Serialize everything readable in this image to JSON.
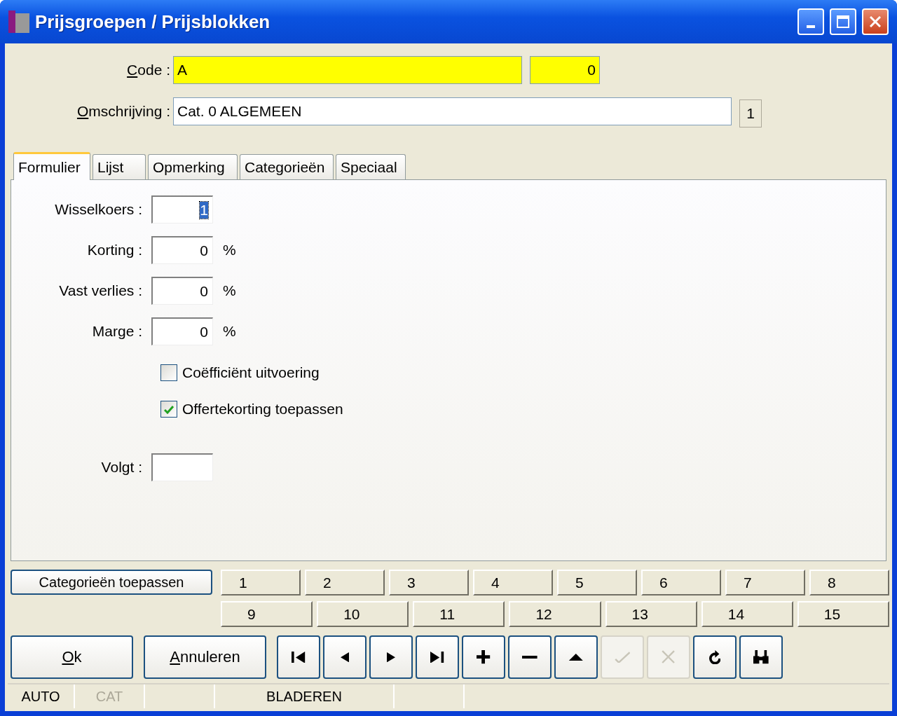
{
  "window": {
    "title": "Prijsgroepen / Prijsblokken"
  },
  "header": {
    "code_label": "Code :",
    "code_underline_first": true,
    "code_value": "A",
    "code_number": "0",
    "description_label": "Omschrijving :",
    "description_underline_first": true,
    "description_value": "Cat. 0  ALGEMEEN",
    "page_indicator": "1"
  },
  "tabs": [
    {
      "label": "Formulier",
      "selected": true
    },
    {
      "label": "Lijst",
      "selected": false
    },
    {
      "label": "Opmerking",
      "selected": false
    },
    {
      "label": "Categorieën",
      "selected": false
    },
    {
      "label": "Speciaal",
      "selected": false
    }
  ],
  "form": {
    "fields": [
      {
        "label": "Wisselkoers :",
        "value": "1",
        "focused": true
      },
      {
        "label": "Korting :",
        "value": "0",
        "unit": "%",
        "focused": false
      },
      {
        "label": "Vast verlies :",
        "value": "0",
        "unit": "%",
        "focused": false
      },
      {
        "label": "Marge :",
        "value": "0",
        "unit": "%",
        "focused": false
      }
    ],
    "checkboxes": [
      {
        "label": "Coëfficiënt uitvoering",
        "checked": false
      },
      {
        "label": "Offertekorting toepassen",
        "checked": true
      }
    ],
    "volgt": {
      "label": "Volgt :"
    }
  },
  "category_button": "Categorieën toepassen",
  "category_rows": [
    [
      "1",
      "2",
      "3",
      "4",
      "5",
      "6",
      "7",
      "8"
    ],
    [
      "9",
      "10",
      "11",
      "12",
      "13",
      "14",
      "15"
    ]
  ],
  "action_buttons": [
    {
      "label": "Ok",
      "underline_first": true
    },
    {
      "label": "Annuleren",
      "underline_first": true
    }
  ],
  "nav_buttons": [
    {
      "kind": "first",
      "disabled": false
    },
    {
      "kind": "prev",
      "disabled": false
    },
    {
      "kind": "next",
      "disabled": false
    },
    {
      "kind": "last",
      "disabled": false
    },
    {
      "kind": "add",
      "disabled": false
    },
    {
      "kind": "remove",
      "disabled": false
    },
    {
      "kind": "up",
      "disabled": false
    },
    {
      "kind": "confirm",
      "disabled": true
    },
    {
      "kind": "cancel",
      "disabled": true
    },
    {
      "kind": "refresh",
      "disabled": false
    },
    {
      "kind": "search",
      "disabled": false
    }
  ],
  "status_bar": [
    {
      "text": "AUTO",
      "disabled": false
    },
    {
      "text": "CAT",
      "disabled": true
    },
    {
      "text": "BLADEREN",
      "disabled": false
    }
  ]
}
